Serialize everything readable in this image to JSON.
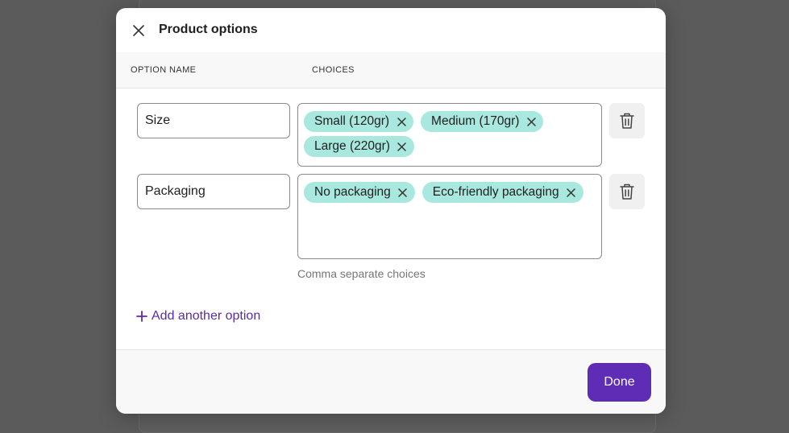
{
  "dialog": {
    "title": "Product options",
    "close_icon": "close-icon"
  },
  "columns": {
    "option_name": "OPTION NAME",
    "choices": "CHOICES"
  },
  "options": [
    {
      "name": "Size",
      "choices": [
        "Small (120gr)",
        "Medium (170gr)",
        "Large (220gr)"
      ]
    },
    {
      "name": "Packaging",
      "choices": [
        "No packaging",
        "Eco-friendly packaging"
      ]
    }
  ],
  "hint": "Comma separate choices",
  "add_option_label": "Add another option",
  "footer": {
    "done_label": "Done"
  },
  "colors": {
    "accent": "#5f2db5",
    "link": "#5a2ba8",
    "chip_bg": "#a9e8de",
    "overlay": "#5b5b5b"
  }
}
